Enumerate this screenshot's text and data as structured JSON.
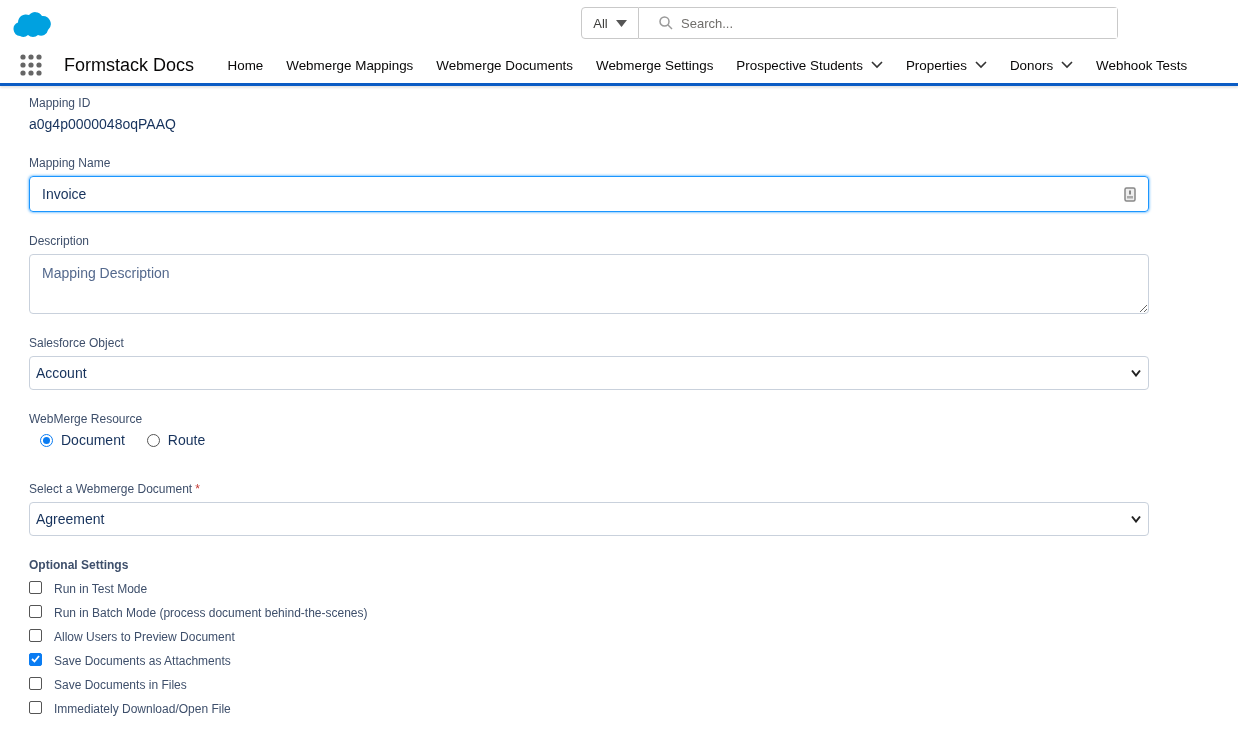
{
  "header": {
    "search": {
      "scope": "All",
      "placeholder": "Search..."
    }
  },
  "nav": {
    "app_name": "Formstack Docs",
    "items": [
      {
        "label": "Home",
        "has_menu": false
      },
      {
        "label": "Webmerge Mappings",
        "has_menu": false
      },
      {
        "label": "Webmerge Documents",
        "has_menu": false
      },
      {
        "label": "Webmerge Settings",
        "has_menu": false
      },
      {
        "label": "Prospective Students",
        "has_menu": true
      },
      {
        "label": "Properties",
        "has_menu": true
      },
      {
        "label": "Donors",
        "has_menu": true
      },
      {
        "label": "Webhook Tests",
        "has_menu": false
      }
    ]
  },
  "form": {
    "mapping_id": {
      "label": "Mapping ID",
      "value": "a0g4p0000048oqPAAQ"
    },
    "mapping_name": {
      "label": "Mapping Name",
      "value": "Invoice",
      "focused": true
    },
    "description": {
      "label": "Description",
      "placeholder": "Mapping Description"
    },
    "salesforce_object": {
      "label": "Salesforce Object",
      "value": "Account"
    },
    "resource": {
      "label": "WebMerge Resource",
      "options": [
        {
          "label": "Document",
          "selected": true
        },
        {
          "label": "Route",
          "selected": false
        }
      ]
    },
    "document": {
      "label": "Select a Webmerge Document",
      "required_mark": "*",
      "value": "Agreement"
    },
    "optional_settings": {
      "title": "Optional Settings",
      "items": [
        {
          "label": "Run in Test Mode",
          "checked": false
        },
        {
          "label": "Run in Batch Mode (process document behind-the-scenes)",
          "checked": false
        },
        {
          "label": "Allow Users to Preview Document",
          "checked": false
        },
        {
          "label": "Save Documents as Attachments",
          "checked": true
        },
        {
          "label": "Save Documents in Files",
          "checked": false
        },
        {
          "label": "Immediately Download/Open File",
          "checked": false
        }
      ]
    }
  }
}
